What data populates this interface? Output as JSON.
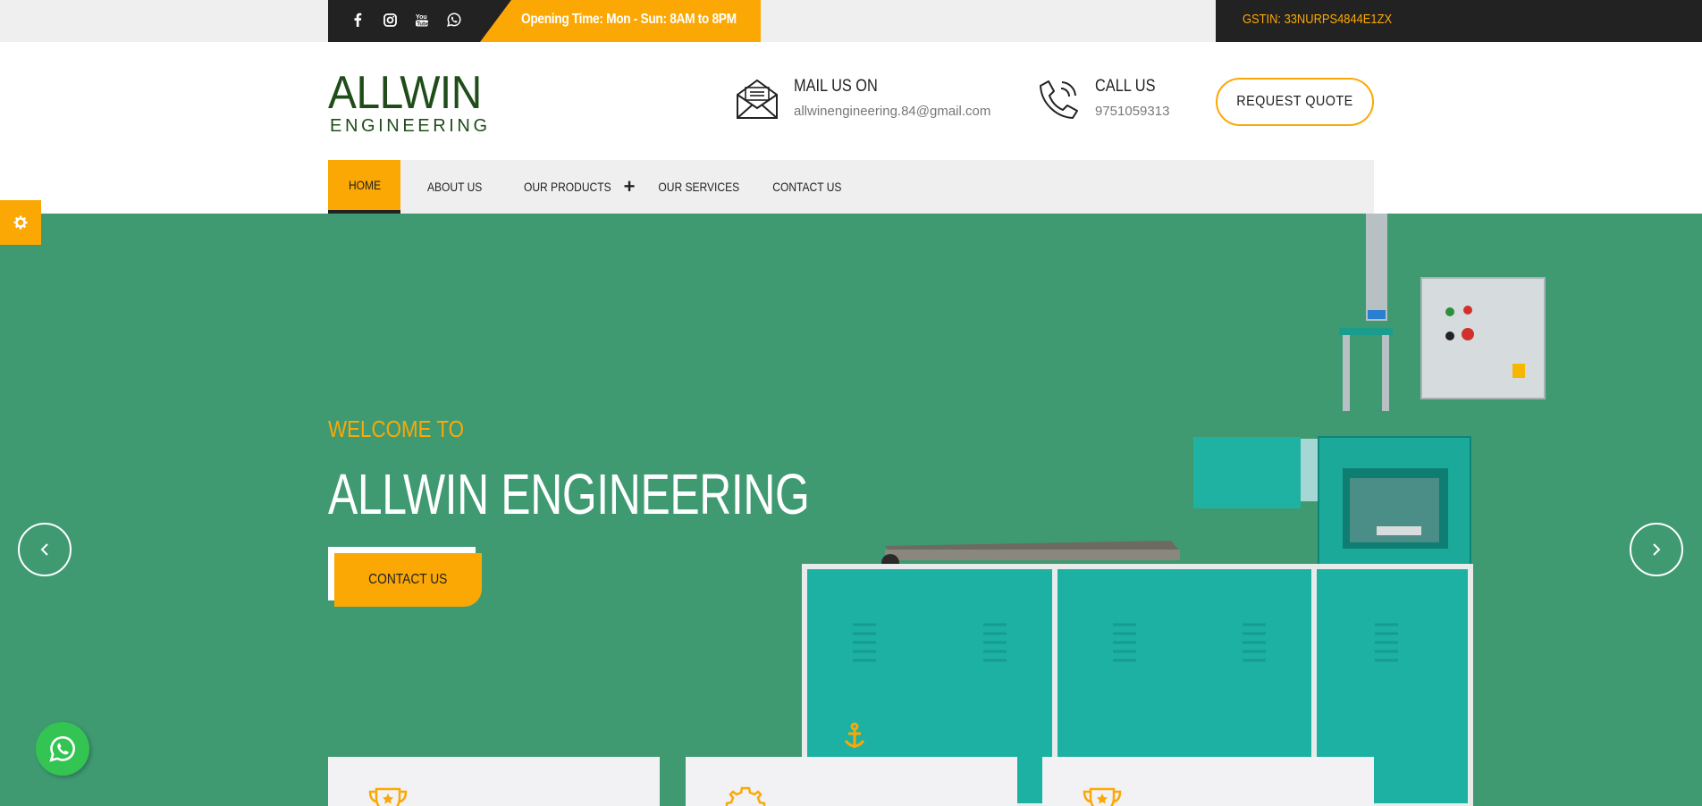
{
  "topbar": {
    "social_icons": [
      "facebook-icon",
      "instagram-icon",
      "youtube-icon",
      "whatsapp-icon"
    ],
    "opening_time": "Opening Time: Mon - Sun: 8AM to 8PM",
    "gstin": "GSTIN: 33NURPS4844E1ZX"
  },
  "header": {
    "logo_line1": "ALLWIN",
    "logo_line2": "ENGINEERING",
    "mail_title": "MAIL US ON",
    "mail_value": "allwinengineering.84@gmail.com",
    "call_title": "CALL US",
    "call_value": "9751059313",
    "quote_button": "REQUEST QUOTE"
  },
  "nav": {
    "items": [
      {
        "label": "HOME",
        "active": true
      },
      {
        "label": "ABOUT US"
      },
      {
        "label": "OUR PRODUCTS",
        "has_submenu": true,
        "submenu_icon": "+"
      },
      {
        "label": "OUR SERVICES"
      },
      {
        "label": "CONTACT US"
      }
    ]
  },
  "hero": {
    "welcome": "WELCOME TO",
    "title": "ALLWIN ENGINEERING",
    "cta": "CONTACT US",
    "prev_icon": "‹",
    "next_icon": "›"
  },
  "colors": {
    "accent": "#fba805",
    "dark": "#222222",
    "hero_bg": "#3f9a72",
    "logo_green": "#1f4d1a",
    "machine_teal": "#17a99a"
  }
}
